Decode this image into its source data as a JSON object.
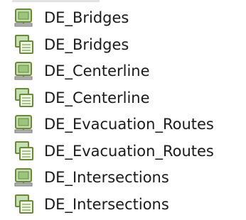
{
  "items": [
    {
      "label": "DE_Bridges",
      "icon": "database-icon"
    },
    {
      "label": "DE_Bridges",
      "icon": "database-stack-icon"
    },
    {
      "label": "DE_Centerline",
      "icon": "database-icon"
    },
    {
      "label": "DE_Centerline",
      "icon": "database-stack-icon"
    },
    {
      "label": "DE_Evacuation_Routes",
      "icon": "database-icon"
    },
    {
      "label": "DE_Evacuation_Routes",
      "icon": "database-stack-icon"
    },
    {
      "label": "DE_Intersections",
      "icon": "database-icon"
    },
    {
      "label": "DE_Intersections",
      "icon": "database-stack-icon"
    }
  ],
  "colors": {
    "icon_fill": "#c5e0b4",
    "icon_stroke": "#6a8a3a",
    "stack_fill": "#eef6e4",
    "text": "#1a1a1a"
  }
}
